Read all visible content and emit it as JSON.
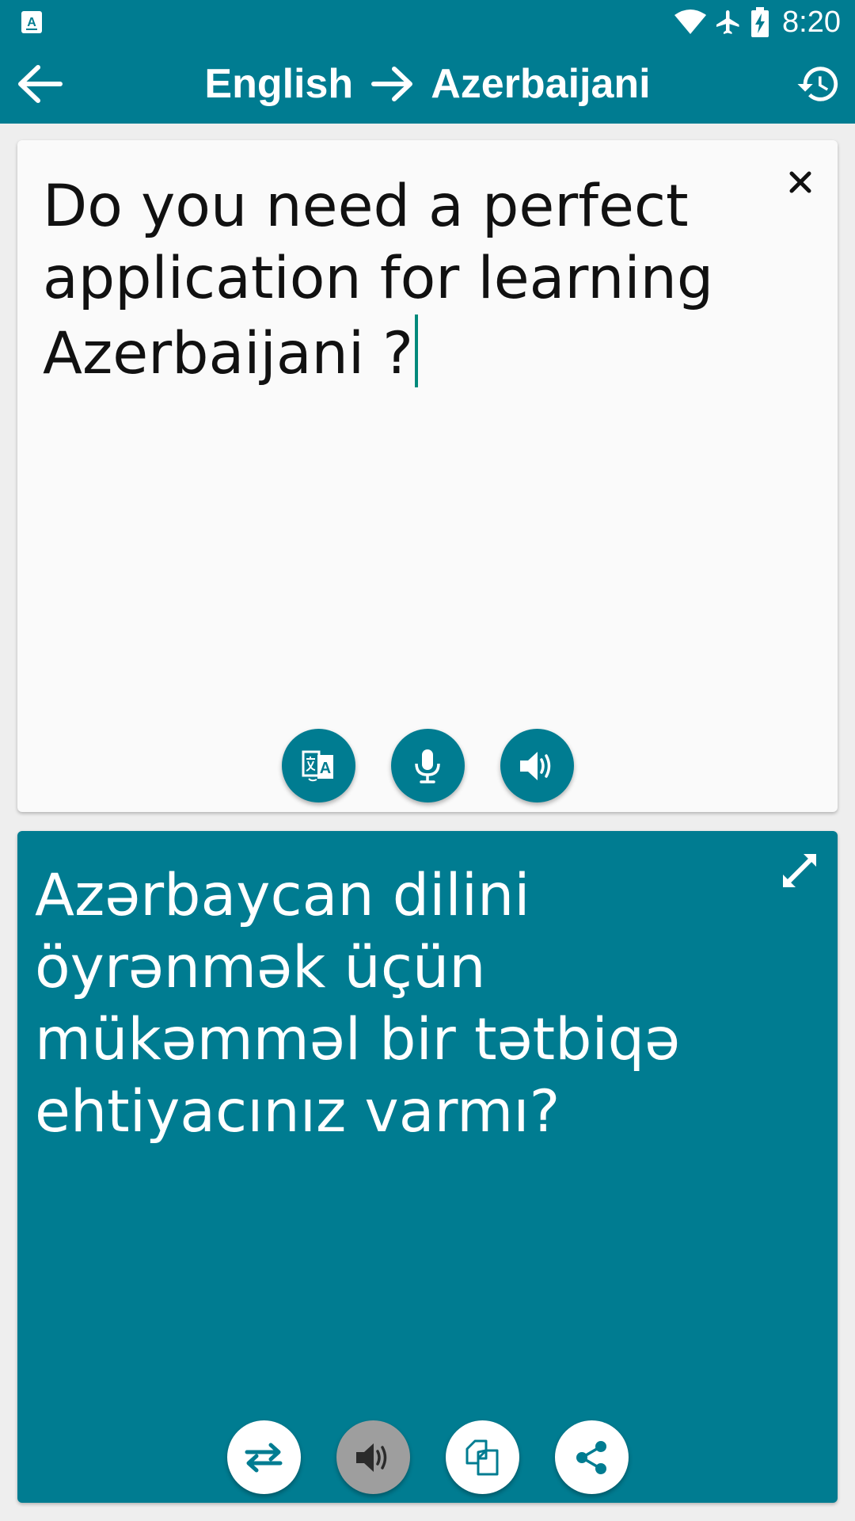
{
  "status_bar": {
    "time": "8:20",
    "icons": [
      "app-notification-icon",
      "wifi-icon",
      "airplane-mode-icon",
      "battery-charging-icon"
    ]
  },
  "app_bar": {
    "source_language": "English",
    "arrow": "→",
    "target_language": "Azerbaijani",
    "back_icon": "arrow-back-icon",
    "history_icon": "history-icon"
  },
  "source": {
    "text": "Do you need a perfect application for learning Azerbaijani ?",
    "actions": [
      "translate-icon",
      "microphone-icon",
      "speaker-icon"
    ]
  },
  "result": {
    "text": "Azərbaycan dilini öyrənmək üçün mükəmməl bir tətbiqə ehtiyacınız varmı?",
    "actions": [
      "swap-icon",
      "speaker-icon",
      "copy-icon",
      "share-icon"
    ]
  },
  "colors": {
    "primary": "#007c91",
    "card": "#fafafa",
    "background": "#eeeeee",
    "cursor": "#00897b",
    "disabled_fab": "#9e9e9e"
  }
}
